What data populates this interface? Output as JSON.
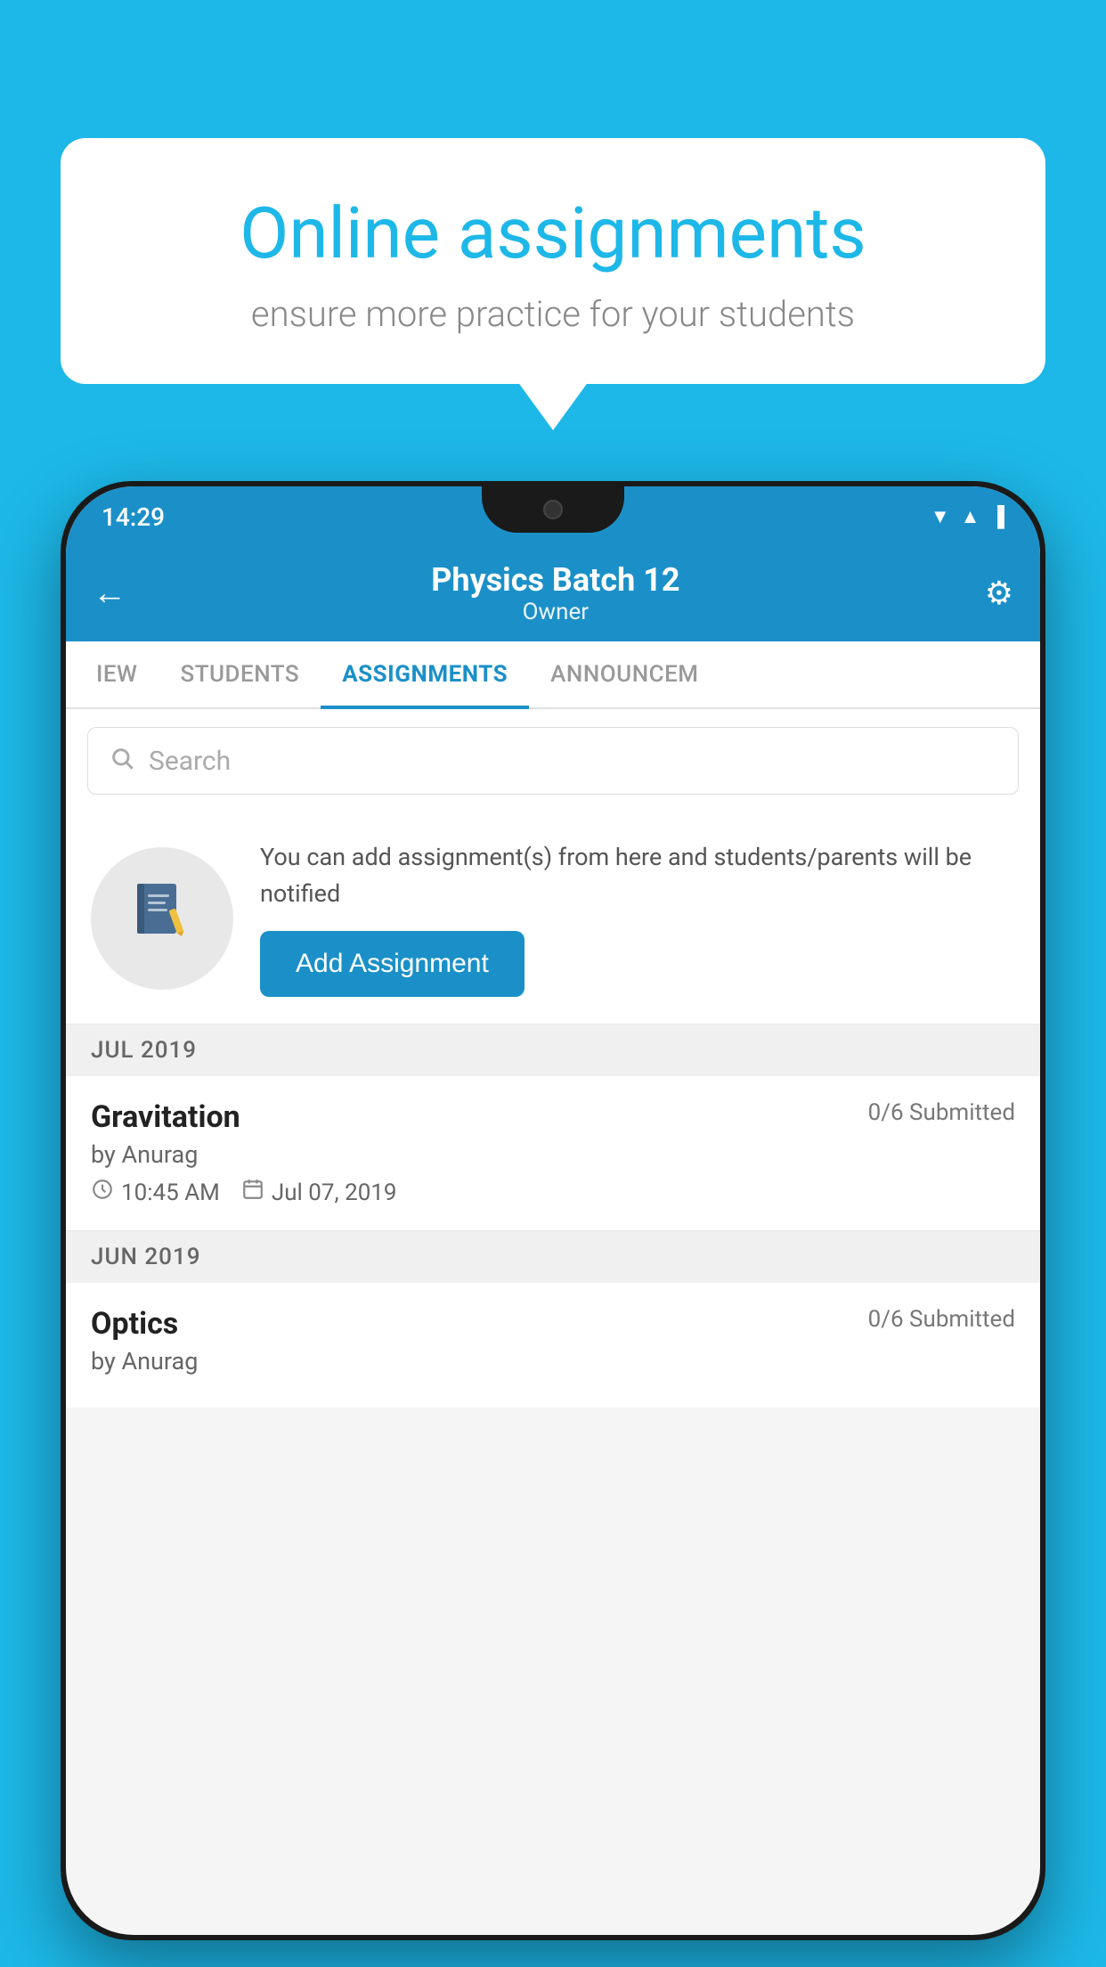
{
  "background_color": "#1DB8E8",
  "speech_bubble": {
    "title": "Online assignments",
    "subtitle": "ensure more practice for your students"
  },
  "phone": {
    "status_bar": {
      "time": "14:29",
      "signal": "▼",
      "bars": "▲",
      "battery": "▐"
    },
    "header": {
      "title": "Physics Batch 12",
      "subtitle": "Owner",
      "back_label": "←",
      "settings_label": "⚙"
    },
    "tabs": [
      {
        "label": "IEW",
        "active": false
      },
      {
        "label": "STUDENTS",
        "active": false
      },
      {
        "label": "ASSIGNMENTS",
        "active": true
      },
      {
        "label": "ANNOUNCEM",
        "active": false
      }
    ],
    "search": {
      "placeholder": "Search"
    },
    "promo": {
      "icon": "📓",
      "text": "You can add assignment(s) from here and students/parents will be notified",
      "button_label": "Add Assignment"
    },
    "sections": [
      {
        "label": "JUL 2019",
        "assignments": [
          {
            "name": "Gravitation",
            "submitted": "0/6 Submitted",
            "by": "by Anurag",
            "time": "10:45 AM",
            "date": "Jul 07, 2019"
          }
        ]
      },
      {
        "label": "JUN 2019",
        "assignments": [
          {
            "name": "Optics",
            "submitted": "0/6 Submitted",
            "by": "by Anurag",
            "time": "",
            "date": ""
          }
        ]
      }
    ]
  }
}
